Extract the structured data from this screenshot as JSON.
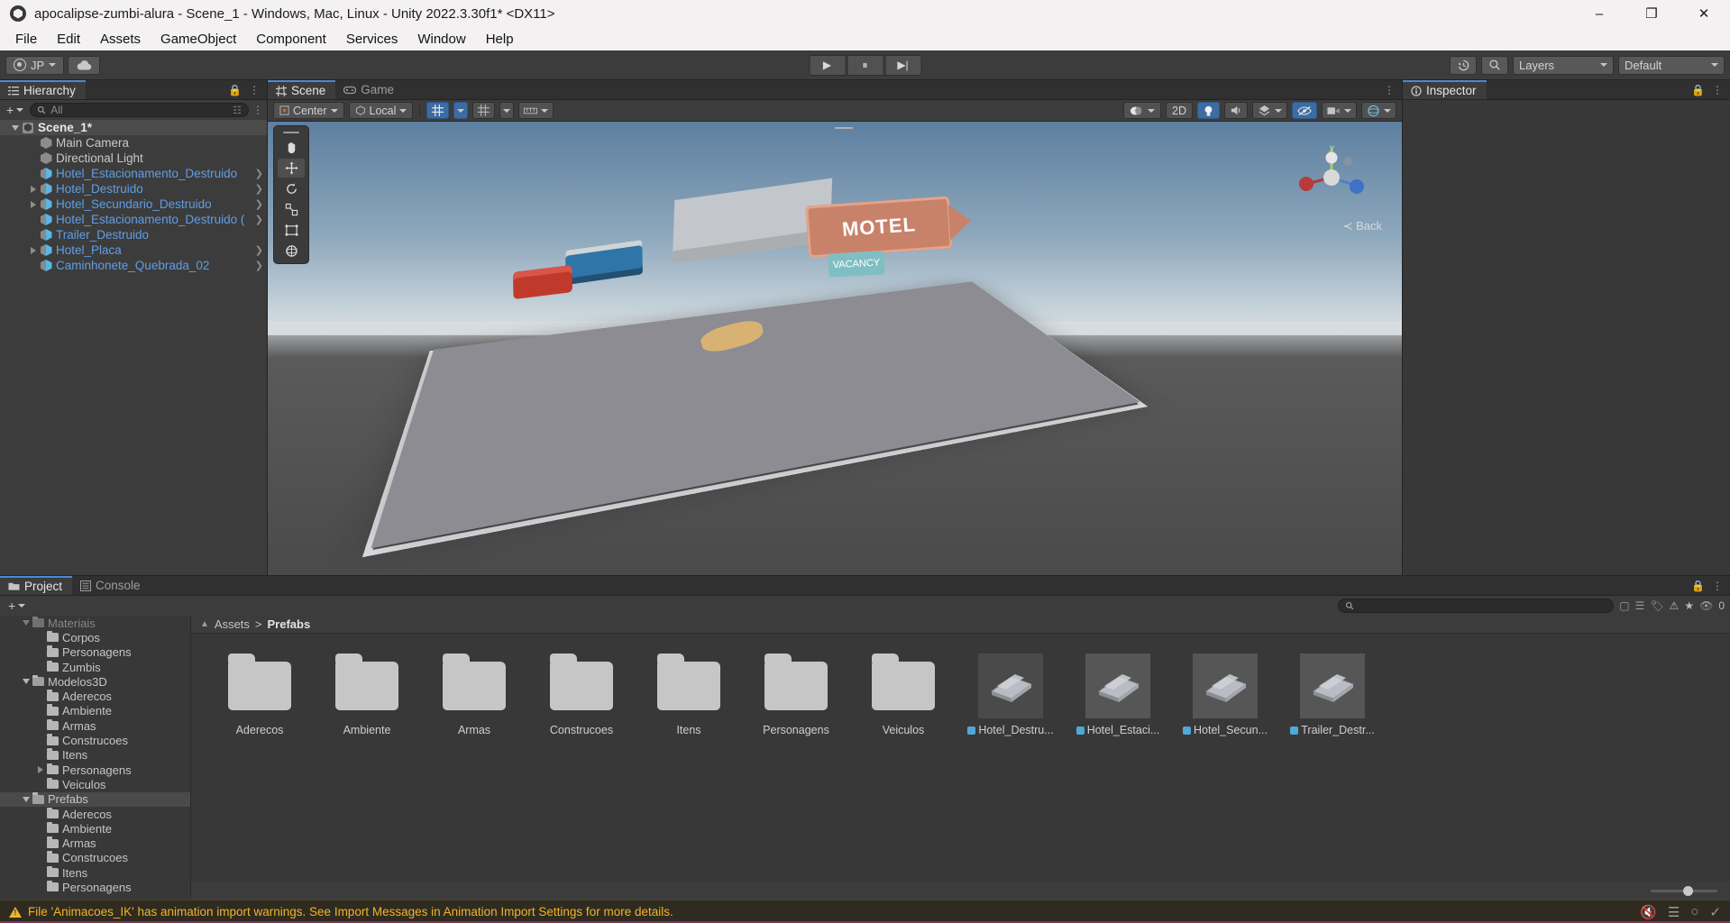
{
  "window": {
    "title": "apocalipse-zumbi-alura - Scene_1 - Windows, Mac, Linux - Unity 2022.3.30f1* <DX11>",
    "minimize": "–",
    "maximize": "❐",
    "close": "✕"
  },
  "menubar": {
    "items": [
      "File",
      "Edit",
      "Assets",
      "GameObject",
      "Component",
      "Services",
      "Window",
      "Help"
    ]
  },
  "toolbar": {
    "account_label": "JP",
    "cloud_icon": "cloud-icon",
    "play_label": "▶",
    "pause_label": "⏸",
    "step_label": "▶|",
    "history_icon": "undo-history-icon",
    "search_icon": "search-icon",
    "layers_label": "Layers",
    "layout_label": "Default"
  },
  "hierarchy": {
    "tab_label": "Hierarchy",
    "tab_icon": "hierarchy-icon",
    "search_placeholder": "All",
    "add_label": "+",
    "items": [
      {
        "label": "Scene_1*",
        "depth": 0,
        "type": "scene",
        "expanded": true,
        "arrow": false,
        "twisty": "open"
      },
      {
        "label": "Main Camera",
        "depth": 1,
        "type": "gameobject",
        "twisty": "none",
        "arrow": false
      },
      {
        "label": "Directional Light",
        "depth": 1,
        "type": "gameobject",
        "twisty": "none",
        "arrow": false
      },
      {
        "label": "Hotel_Estacionamento_Destruido",
        "depth": 1,
        "type": "prefab",
        "twisty": "none",
        "arrow": true
      },
      {
        "label": "Hotel_Destruido",
        "depth": 1,
        "type": "prefab",
        "twisty": "closed",
        "arrow": true
      },
      {
        "label": "Hotel_Secundario_Destruido",
        "depth": 1,
        "type": "prefab",
        "twisty": "closed",
        "arrow": true
      },
      {
        "label": "Hotel_Estacionamento_Destruido (",
        "depth": 1,
        "type": "prefab",
        "twisty": "none",
        "arrow": true
      },
      {
        "label": "Trailer_Destruido",
        "depth": 1,
        "type": "prefab",
        "twisty": "none",
        "arrow": false
      },
      {
        "label": "Hotel_Placa",
        "depth": 1,
        "type": "prefab",
        "twisty": "closed",
        "arrow": true
      },
      {
        "label": "Caminhonete_Quebrada_02",
        "depth": 1,
        "type": "prefab",
        "twisty": "none",
        "arrow": true
      }
    ]
  },
  "scene_panel": {
    "tabs": [
      {
        "label": "Scene",
        "icon": "scene-grid-icon",
        "active": true
      },
      {
        "label": "Game",
        "icon": "gamepad-icon",
        "active": false
      }
    ],
    "toolbar": {
      "pivot_label": "Center",
      "handle_label": "Local",
      "grid_snap_icon": "grid-snap-icon",
      "snap_increment_icon": "snap-increment-icon",
      "ruler_icon": "ruler-icon",
      "view_2d_label": "2D",
      "lighting_icon": "lighting-icon",
      "audio_icon": "audio-icon",
      "fx_icon": "fx-icon",
      "hidden_icon": "hidden-objects-icon",
      "camera_icon": "scene-camera-icon",
      "gizmos_icon": "gizmos-icon"
    },
    "overlay_tools": [
      {
        "icon": "hand-tool-icon",
        "selected": false
      },
      {
        "icon": "move-tool-icon",
        "selected": true
      },
      {
        "icon": "rotate-tool-icon",
        "selected": false
      },
      {
        "icon": "scale-tool-icon",
        "selected": false
      },
      {
        "icon": "rect-tool-icon",
        "selected": false
      },
      {
        "icon": "transform-tool-icon",
        "selected": false
      }
    ],
    "gizmo": {
      "back_label": "≺ Back",
      "y_label": "y"
    },
    "scene_objects": {
      "motel_sign": "MOTEL",
      "vacancy_sign": "VACANCY"
    }
  },
  "inspector": {
    "tab_label": "Inspector",
    "tab_icon": "inspector-icon",
    "lock_icon": "lock-icon",
    "menu_icon": "kebab-menu-icon"
  },
  "project": {
    "tabs": [
      {
        "label": "Project",
        "icon": "folder-icon",
        "active": true
      },
      {
        "label": "Console",
        "icon": "console-icon",
        "active": false
      }
    ],
    "add_label": "+",
    "search_placeholder": "",
    "search_icon": "search-icon",
    "filter_icons": [
      "search-by-type-icon",
      "search-by-label-icon",
      "warning-filter-icon",
      "favorite-icon"
    ],
    "eye_count": "0",
    "breadcrumb": {
      "root": "Assets",
      "separator": ">",
      "current": "Prefabs"
    },
    "tree": [
      {
        "label": "Materiais",
        "depth": 1,
        "twisty": "open",
        "open_folder": true,
        "clipped": true
      },
      {
        "label": "Corpos",
        "depth": 2,
        "twisty": "none"
      },
      {
        "label": "Personagens",
        "depth": 2,
        "twisty": "none"
      },
      {
        "label": "Zumbis",
        "depth": 2,
        "twisty": "none"
      },
      {
        "label": "Modelos3D",
        "depth": 1,
        "twisty": "open",
        "open_folder": true
      },
      {
        "label": "Aderecos",
        "depth": 2,
        "twisty": "none"
      },
      {
        "label": "Ambiente",
        "depth": 2,
        "twisty": "none"
      },
      {
        "label": "Armas",
        "depth": 2,
        "twisty": "none"
      },
      {
        "label": "Construcoes",
        "depth": 2,
        "twisty": "none"
      },
      {
        "label": "Itens",
        "depth": 2,
        "twisty": "none"
      },
      {
        "label": "Personagens",
        "depth": 2,
        "twisty": "closed"
      },
      {
        "label": "Veiculos",
        "depth": 2,
        "twisty": "none"
      },
      {
        "label": "Prefabs",
        "depth": 1,
        "twisty": "open",
        "open_folder": true,
        "selected": true
      },
      {
        "label": "Aderecos",
        "depth": 2,
        "twisty": "none"
      },
      {
        "label": "Ambiente",
        "depth": 2,
        "twisty": "none"
      },
      {
        "label": "Armas",
        "depth": 2,
        "twisty": "none"
      },
      {
        "label": "Construcoes",
        "depth": 2,
        "twisty": "none"
      },
      {
        "label": "Itens",
        "depth": 2,
        "twisty": "none"
      },
      {
        "label": "Personagens",
        "depth": 2,
        "twisty": "none"
      }
    ],
    "assets": [
      {
        "label": "Aderecos",
        "kind": "folder"
      },
      {
        "label": "Ambiente",
        "kind": "folder"
      },
      {
        "label": "Armas",
        "kind": "folder"
      },
      {
        "label": "Construcoes",
        "kind": "folder"
      },
      {
        "label": "Itens",
        "kind": "folder"
      },
      {
        "label": "Personagens",
        "kind": "folder"
      },
      {
        "label": "Veiculos",
        "kind": "folder"
      },
      {
        "label": "Hotel_Destru...",
        "kind": "prefab",
        "selected": true
      },
      {
        "label": "Hotel_Estaci...",
        "kind": "prefab"
      },
      {
        "label": "Hotel_Secun...",
        "kind": "prefab"
      },
      {
        "label": "Trailer_Destr...",
        "kind": "prefab"
      }
    ]
  },
  "statusbar": {
    "warning_icon": "warning-triangle-icon",
    "message": "File 'Animacoes_IK' has animation import warnings. See Import Messages in Animation Import Settings for more details.",
    "right_icons": [
      "mute-audio-icon",
      "layers-status-icon",
      "collab-status-icon",
      "check-status-icon"
    ]
  },
  "colors": {
    "accent_blue": "#4a8ad4",
    "prefab_blue": "#5f9ee6",
    "warning_yellow": "#f0b429",
    "panel_bg": "#383838",
    "toolbar_bg": "#3c3c3c"
  }
}
